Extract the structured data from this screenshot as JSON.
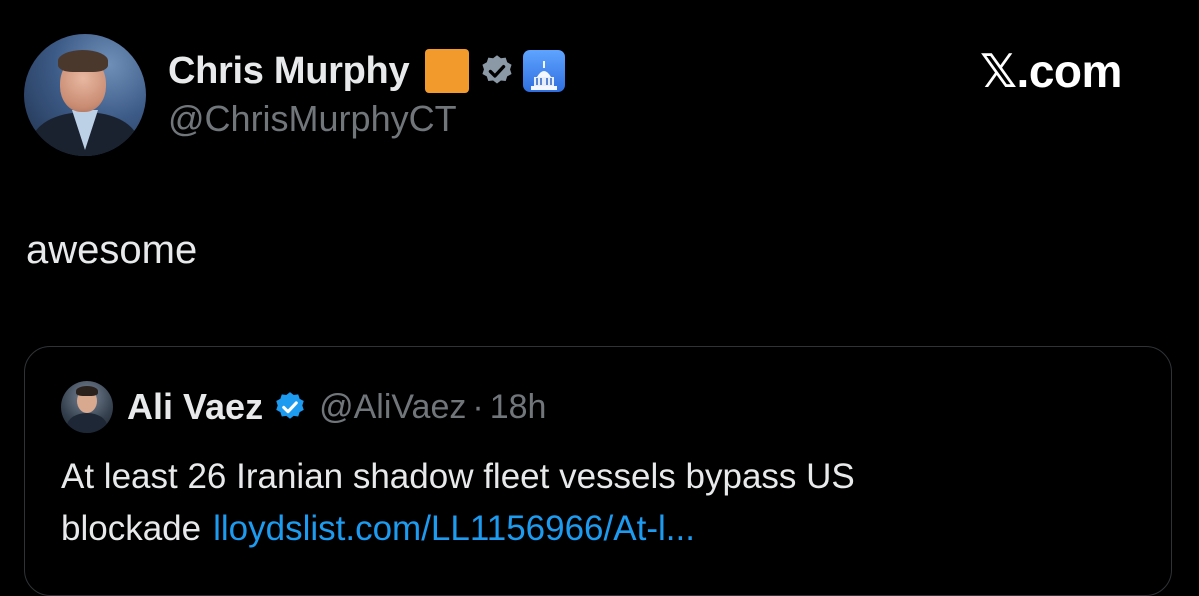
{
  "author": {
    "name": "Chris Murphy",
    "handle": "@ChrisMurphyCT",
    "badges": [
      "orange-square",
      "verified-badge-icon",
      "capitol-icon"
    ]
  },
  "brand": {
    "label": "𝕏.com"
  },
  "tweet": {
    "text": "awesome"
  },
  "quote": {
    "name": "Ali Vaez",
    "handle": "@AliVaez",
    "separator": "·",
    "time": "18h",
    "text": "At least 26 Iranian shadow fleet vessels bypass US blockade",
    "link": "lloydslist.com/LL1156966/At-l..."
  },
  "colors": {
    "background": "#000000",
    "text": "#e7e9ea",
    "muted": "#71767b",
    "link": "#1d9bf0",
    "border": "#2f3336",
    "orange_badge": "#f39a2c"
  }
}
